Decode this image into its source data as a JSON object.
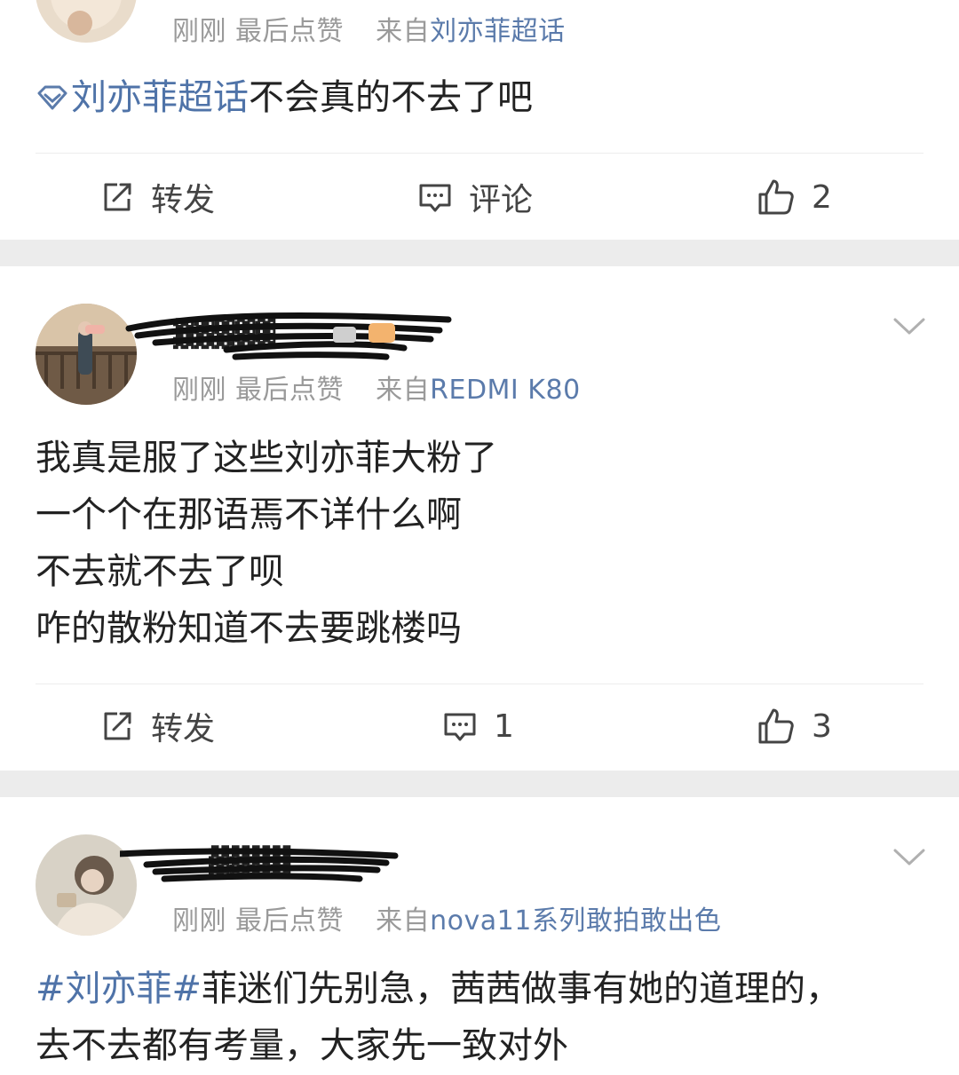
{
  "posts": [
    {
      "meta": {
        "time": "刚刚",
        "liked": "最后点赞",
        "from_prefix": "来自",
        "source": "刘亦菲超话"
      },
      "content": {
        "topic": "刘亦菲超话",
        "text": "不会真的不去了吧"
      },
      "actions": {
        "repost": "转发",
        "comment": "评论",
        "like": "2"
      }
    },
    {
      "meta": {
        "time": "刚刚",
        "liked": "最后点赞",
        "from_prefix": "来自",
        "source": "REDMI K80"
      },
      "content": {
        "lines": [
          "我真是服了这些刘亦菲大粉了",
          "一个个在那语焉不详什么啊",
          "不去就不去了呗",
          "咋的散粉知道不去要跳楼吗"
        ]
      },
      "actions": {
        "repost": "转发",
        "comment": "1",
        "like": "3"
      }
    },
    {
      "meta": {
        "time": "刚刚",
        "liked": "最后点赞",
        "from_prefix": "来自",
        "source": "nova11系列敢拍敢出色"
      },
      "content": {
        "topic": "#刘亦菲#",
        "line1": "菲迷们先别急，茜茜做事有她的道理的，",
        "line2": "去不去都有考量，大家先一致对外"
      }
    }
  ],
  "colors": {
    "link": "#5b7bab",
    "meta": "#9a9a9a",
    "text": "#222222",
    "gap": "#ececec"
  },
  "icons": [
    "repost-icon",
    "comment-icon",
    "like-icon",
    "chevron-down-icon",
    "super-topic-icon"
  ]
}
